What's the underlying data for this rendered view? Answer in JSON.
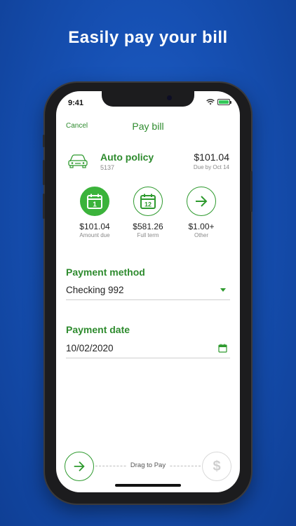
{
  "headline": "Easily pay your bill",
  "status": {
    "time": "9:41"
  },
  "nav": {
    "cancel": "Cancel",
    "title": "Pay bill"
  },
  "policy": {
    "name": "Auto policy",
    "number": "5137",
    "amount": "$101.04",
    "due": "Due by Oct 14",
    "icon": "car-icon"
  },
  "choices": [
    {
      "amount": "$101.04",
      "label": "Amount due",
      "icon_text": "1",
      "icon": "calendar-icon",
      "selected": true
    },
    {
      "amount": "$581.26",
      "label": "Full term",
      "icon_text": "12",
      "icon": "calendar-icon",
      "selected": false
    },
    {
      "amount": "$1.00+",
      "label": "Other",
      "icon": "arrow-right-icon",
      "selected": false
    }
  ],
  "payment_method": {
    "label": "Payment method",
    "value": "Checking 992"
  },
  "payment_date": {
    "label": "Payment date",
    "value": "10/02/2020"
  },
  "slider": {
    "label": "Drag to Pay",
    "target_symbol": "$"
  },
  "colors": {
    "accent": "#2e8b2e",
    "background": "#1650b3"
  }
}
